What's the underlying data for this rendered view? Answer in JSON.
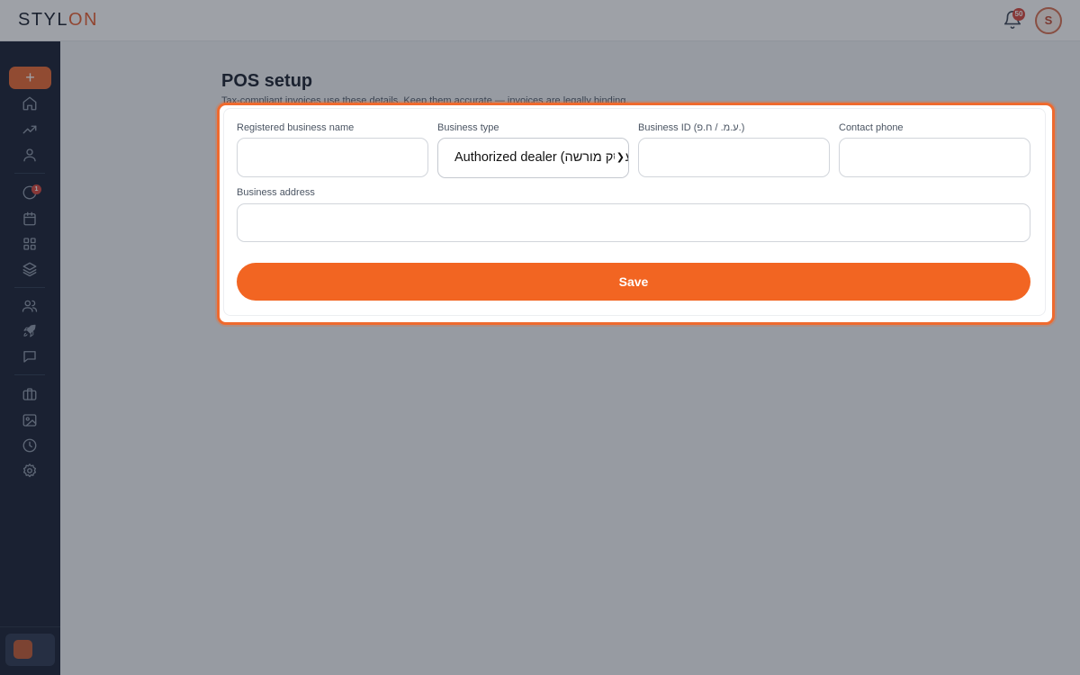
{
  "brand": {
    "prefix": "STYL",
    "suffix": "ON",
    "accent_color": "#e85a2a"
  },
  "header": {
    "notification_count": "50",
    "avatar_initial": "S"
  },
  "sidebar": {
    "new_label": "+",
    "history_badge": "1",
    "icons": [
      "home-icon",
      "trending-icon",
      "user-icon",
      "history-icon",
      "calendar-icon",
      "grid-icon",
      "layers-icon",
      "users-icon",
      "rocket-icon",
      "chat-icon",
      "briefcase-icon",
      "image-icon",
      "clock-icon",
      "gear-icon"
    ]
  },
  "page": {
    "title": "POS setup",
    "subtitle": "Tax-compliant invoices use these details. Keep them accurate — invoices are legally binding."
  },
  "form": {
    "business_name_label": "Registered business name",
    "business_name_value": "",
    "business_type_label": "Business type",
    "business_type_value": "Authorized dealer (עוסק מורשה)",
    "business_id_label": "Business ID (ע.מ. / ח.פ.)",
    "business_id_value": "",
    "phone_label": "Contact phone",
    "phone_value": "",
    "address_label": "Business address",
    "address_value": "",
    "save_label": "Save"
  },
  "colors": {
    "primary": "#f26522",
    "highlight_ring": "#ef6a2e",
    "sidebar_bg": "#0f172a"
  }
}
